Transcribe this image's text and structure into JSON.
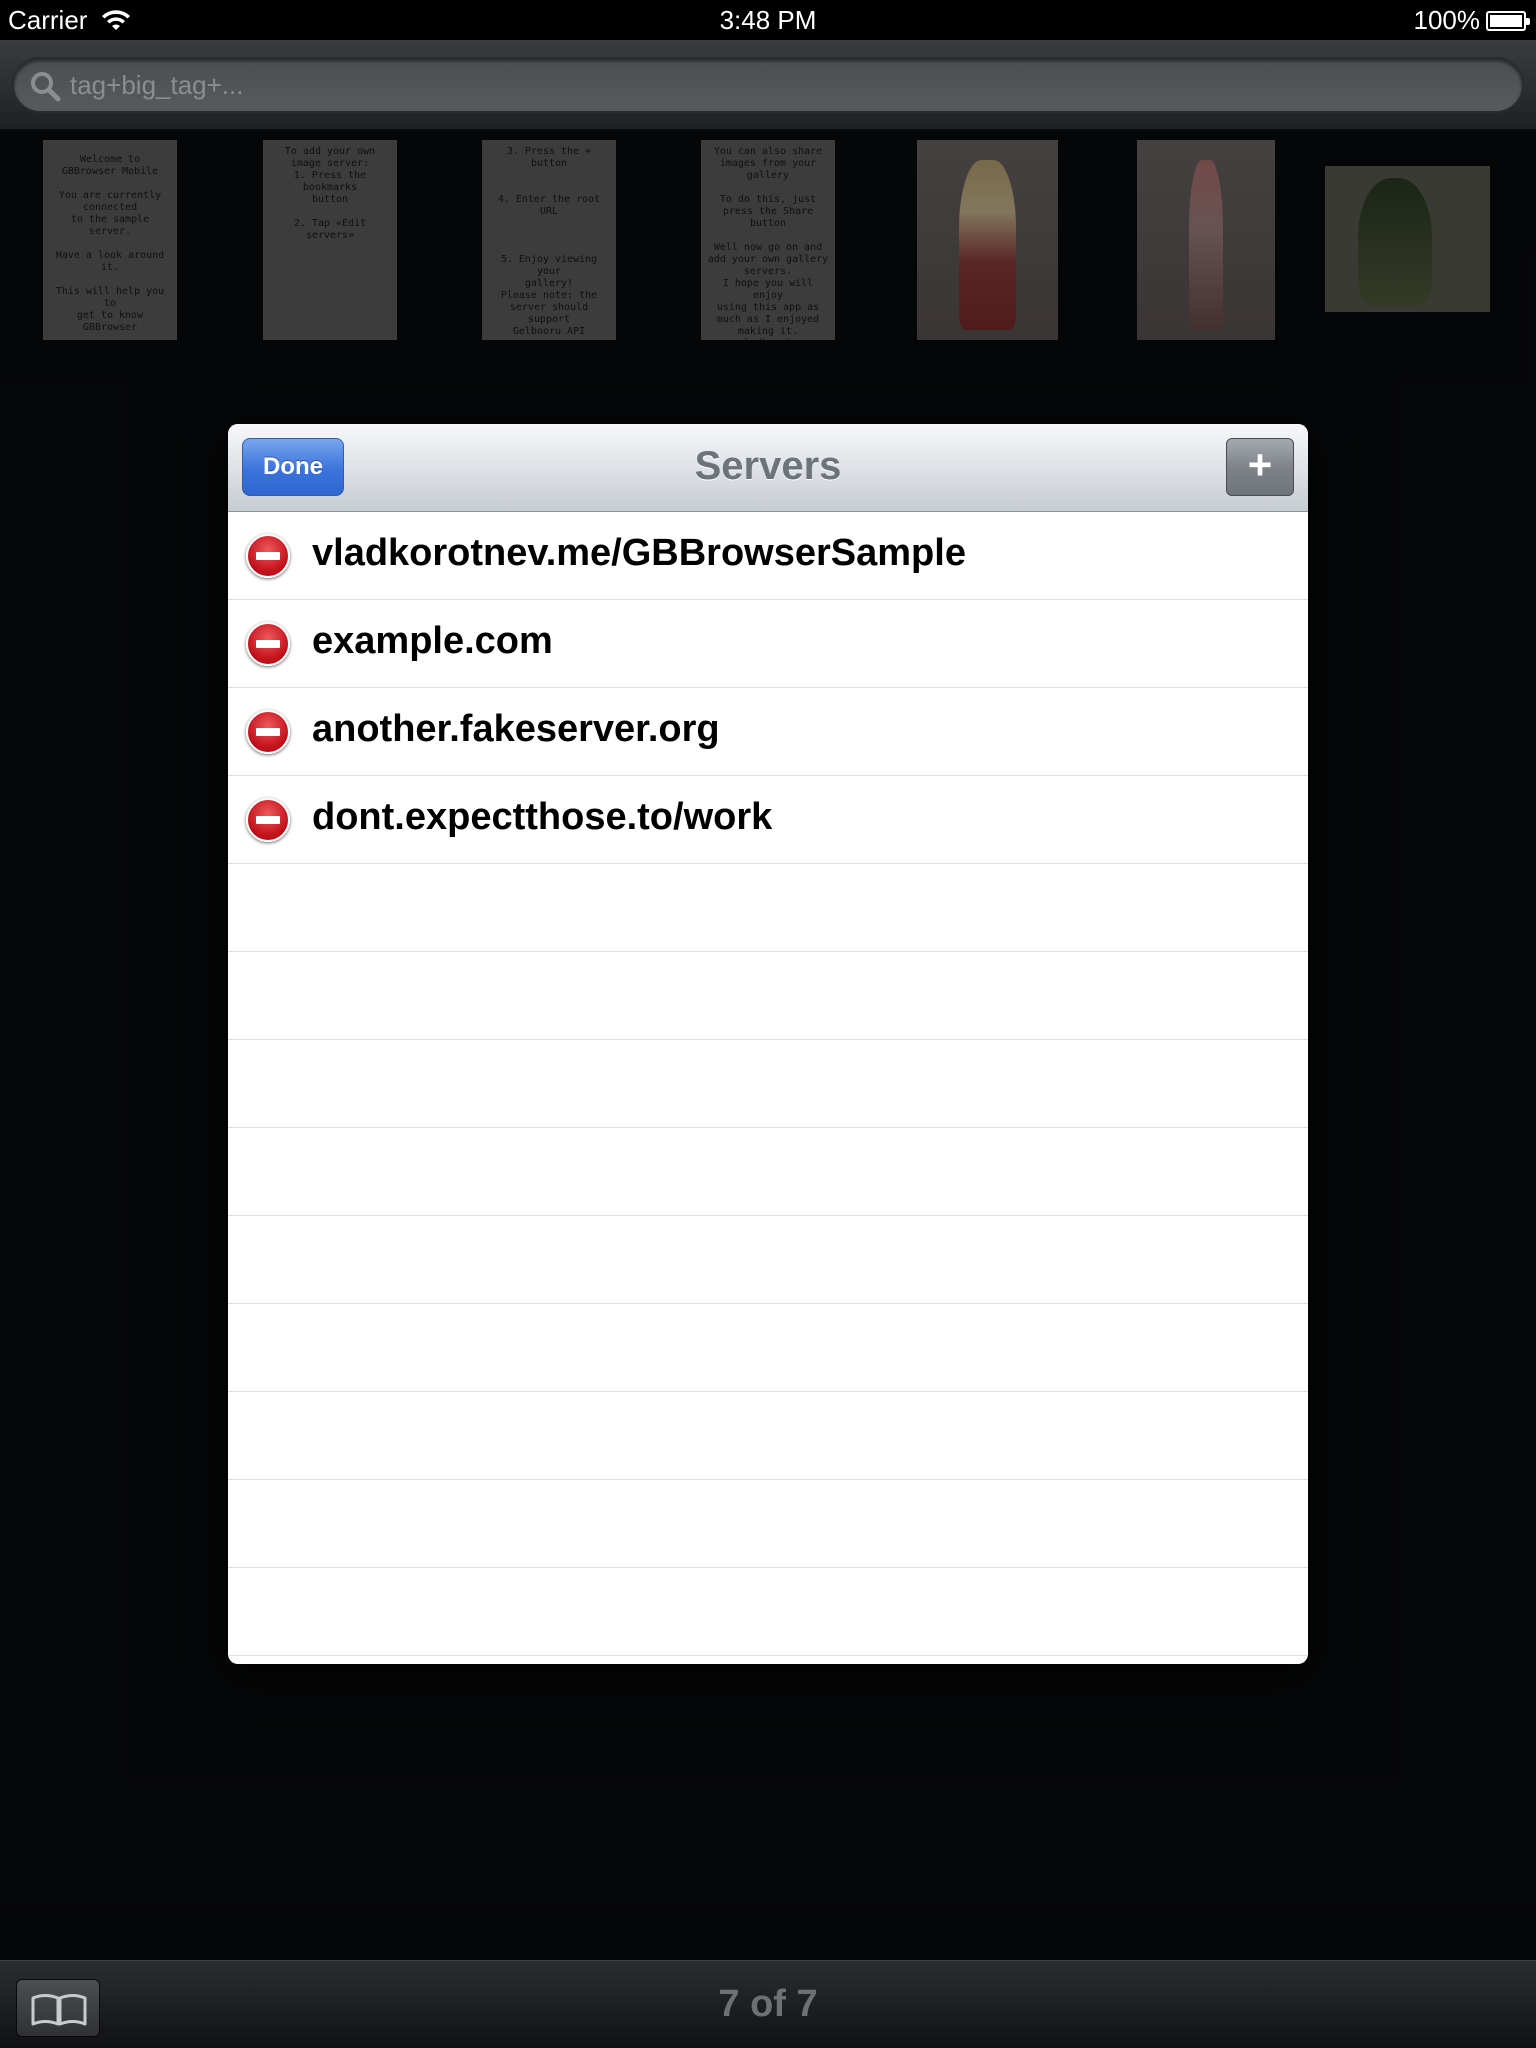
{
  "status_bar": {
    "carrier": "Carrier",
    "time": "3:48 PM",
    "battery": "100%",
    "battery_level": 1.0
  },
  "search": {
    "placeholder": "tag+big_tag+..."
  },
  "thumbnails": [
    {
      "text": "Welcome to\nGBBrowser Mobile\n\nYou are currently connected\nto the sample server.\n\nHave a look around it.\n\nThis will help you to\nget to know GBBrowser"
    },
    {
      "text": "To add your own\nimage server:\n1. Press the bookmarks\nbutton\n\n2. Tap «Edit servers»"
    },
    {
      "text": "3. Press the + button\n\n\n4. Enter the root URL\n\n\n\n5. Enjoy viewing your\ngallery!\nPlease note: the server should support\nGelbooru API"
    },
    {
      "text": "You can also share\nimages from your gallery\n\nTo do this, just\npress the Share button\n\nWell now go on and\nadd your own gallery\nservers.\nI hope you will enjoy\nusing this app as\nmuch as I enjoyed\nmaking it.\n~ vladkorotnev"
    }
  ],
  "servers_panel": {
    "title": "Servers",
    "done_label": "Done",
    "add_label": "+",
    "servers": [
      "vladkorotnev.me/GBBrowserSample",
      "example.com",
      "another.fakeserver.org",
      "dont.expectthose.to/work"
    ]
  },
  "toolbar": {
    "page_counter": "7 of 7"
  }
}
